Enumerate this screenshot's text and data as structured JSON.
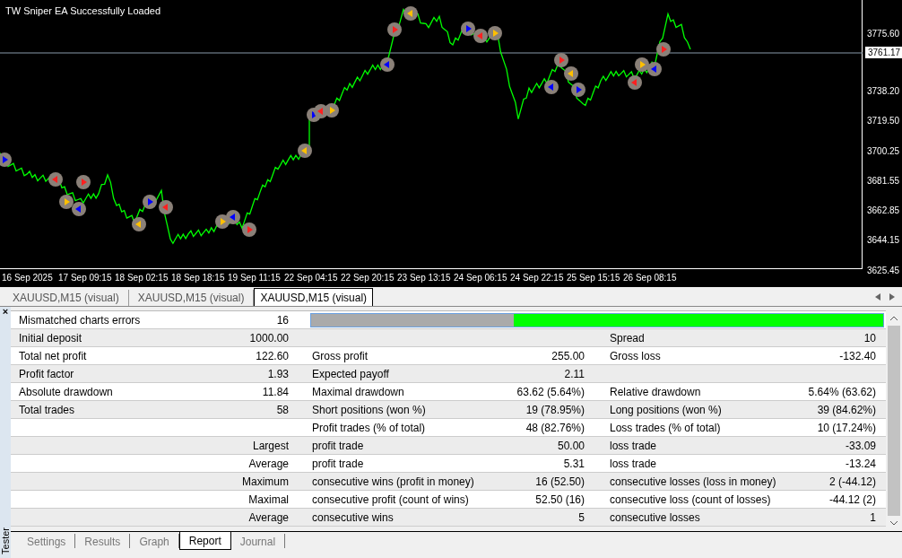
{
  "chart": {
    "message": "TW Sniper EA Successfully Loaded",
    "price_labels": [
      "3775.60",
      "3738.20",
      "3719.50",
      "3700.25",
      "3681.55",
      "3662.85",
      "3644.15",
      "3625.45"
    ],
    "current_price": "3761.17",
    "time_labels": [
      "16 Sep 2025",
      "17 Sep 09:15",
      "18 Sep 02:15",
      "18 Sep 18:15",
      "19 Sep 11:15",
      "22 Sep 04:15",
      "22 Sep 20:15",
      "23 Sep 13:15",
      "24 Sep 06:15",
      "24 Sep 22:15",
      "25 Sep 15:15",
      "26 Sep 08:15"
    ]
  },
  "chart_tabs": [
    {
      "label": "XAUUSD,M15 (visual)",
      "selected": false
    },
    {
      "label": "XAUUSD,M15 (visual)",
      "selected": false
    },
    {
      "label": "XAUUSD,M15 (visual)",
      "selected": true
    }
  ],
  "tester": {
    "title": "Tester",
    "close": "×",
    "mismatch": {
      "label": "Mismatched charts errors",
      "value": "16",
      "level": 0.646
    },
    "rows": [
      [
        "Initial deposit",
        "1000.00",
        "",
        "",
        "Spread",
        "10"
      ],
      [
        "Total net profit",
        "122.60",
        "Gross profit",
        "255.00",
        "Gross loss",
        "-132.40"
      ],
      [
        "Profit factor",
        "1.93",
        "Expected payoff",
        "2.11",
        "",
        ""
      ],
      [
        "Absolute drawdown",
        "11.84",
        "Maximal drawdown",
        "63.62 (5.64%)",
        "Relative drawdown",
        "5.64% (63.62)"
      ],
      [
        "Total trades",
        "58",
        "Short positions (won %)",
        "19 (78.95%)",
        "Long positions (won %)",
        "39 (84.62%)"
      ],
      [
        "",
        "",
        "Profit trades (% of total)",
        "48 (82.76%)",
        "Loss trades (% of total)",
        "10 (17.24%)"
      ],
      [
        "",
        "Largest",
        "profit trade",
        "50.00",
        "loss trade",
        "-33.09"
      ],
      [
        "",
        "Average",
        "profit trade",
        "5.31",
        "loss trade",
        "-13.24"
      ],
      [
        "",
        "Maximum",
        "consecutive wins (profit in money)",
        "16 (52.50)",
        "consecutive losses (loss in money)",
        "2 (-44.12)"
      ],
      [
        "",
        "Maximal",
        "consecutive profit (count of wins)",
        "52.50 (16)",
        "consecutive loss (count of losses)",
        "-44.12 (2)"
      ],
      [
        "",
        "Average",
        "consecutive wins",
        "5",
        "consecutive losses",
        "1"
      ]
    ],
    "tabs": [
      {
        "label": "Settings",
        "selected": false
      },
      {
        "label": "Results",
        "selected": false
      },
      {
        "label": "Graph",
        "selected": false
      },
      {
        "label": "Report",
        "selected": true
      },
      {
        "label": "Journal",
        "selected": false
      }
    ]
  }
}
